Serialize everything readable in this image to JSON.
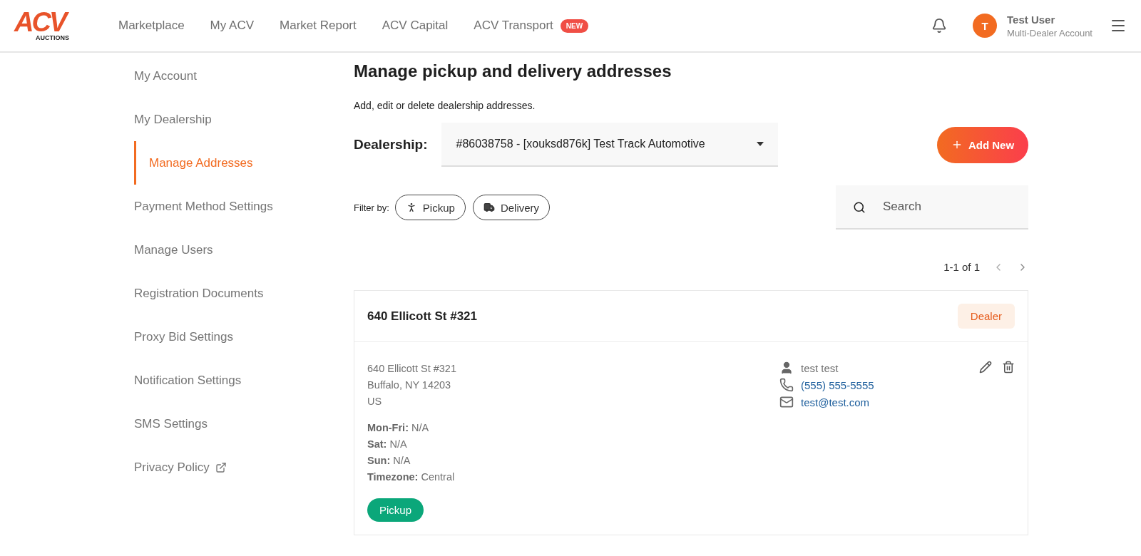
{
  "header": {
    "logo": {
      "text": "ACV",
      "subtext": "AUCTIONS"
    },
    "nav": [
      {
        "label": "Marketplace"
      },
      {
        "label": "My ACV"
      },
      {
        "label": "Market Report"
      },
      {
        "label": "ACV Capital"
      },
      {
        "label": "ACV Transport",
        "badge": "NEW"
      }
    ],
    "user": {
      "initial": "T",
      "name": "Test User",
      "account": "Multi-Dealer Account"
    }
  },
  "sidebar": {
    "items": [
      {
        "label": "My Account",
        "selected": false,
        "external": false
      },
      {
        "label": "My Dealership",
        "selected": false,
        "external": false
      },
      {
        "label": "Manage Addresses",
        "selected": true,
        "external": false
      },
      {
        "label": "Payment Method Settings",
        "selected": false,
        "external": false
      },
      {
        "label": "Manage Users",
        "selected": false,
        "external": false
      },
      {
        "label": "Registration Documents",
        "selected": false,
        "external": false
      },
      {
        "label": "Proxy Bid Settings",
        "selected": false,
        "external": false
      },
      {
        "label": "Notification Settings",
        "selected": false,
        "external": false
      },
      {
        "label": "SMS Settings",
        "selected": false,
        "external": false
      },
      {
        "label": "Privacy Policy",
        "selected": false,
        "external": true
      }
    ]
  },
  "main": {
    "title": "Manage pickup and delivery addresses",
    "subtitle": "Add, edit or delete dealership addresses.",
    "dealership": {
      "label": "Dealership:",
      "value": "#86038758 - [xouksd876k] Test Track Automotive"
    },
    "add_button": "Add New",
    "filter": {
      "label": "Filter by:",
      "chips": [
        {
          "kind": "pickup",
          "label": "Pickup",
          "selected": false
        },
        {
          "kind": "delivery",
          "label": "Delivery",
          "selected": false
        }
      ]
    },
    "search": {
      "placeholder": "Search"
    },
    "pagination": {
      "range": "1-1 of 1"
    },
    "cards": [
      {
        "title": "640 Ellicott St #321",
        "badge": "Dealer",
        "address": [
          "640 Ellicott St #321",
          "Buffalo, NY 14203",
          "US"
        ],
        "hours": [
          "**Mon-Fri:** N/A",
          "**Sat:** N/A",
          "**Sun:** N/A",
          "**Timezone:** Central"
        ],
        "contact": {
          "name": "test test",
          "phone": "(555) 555-5555",
          "email": "test@test.com"
        },
        "tags": [
          {
            "kind": "pickup",
            "label": "Pickup"
          }
        ]
      }
    ]
  }
}
